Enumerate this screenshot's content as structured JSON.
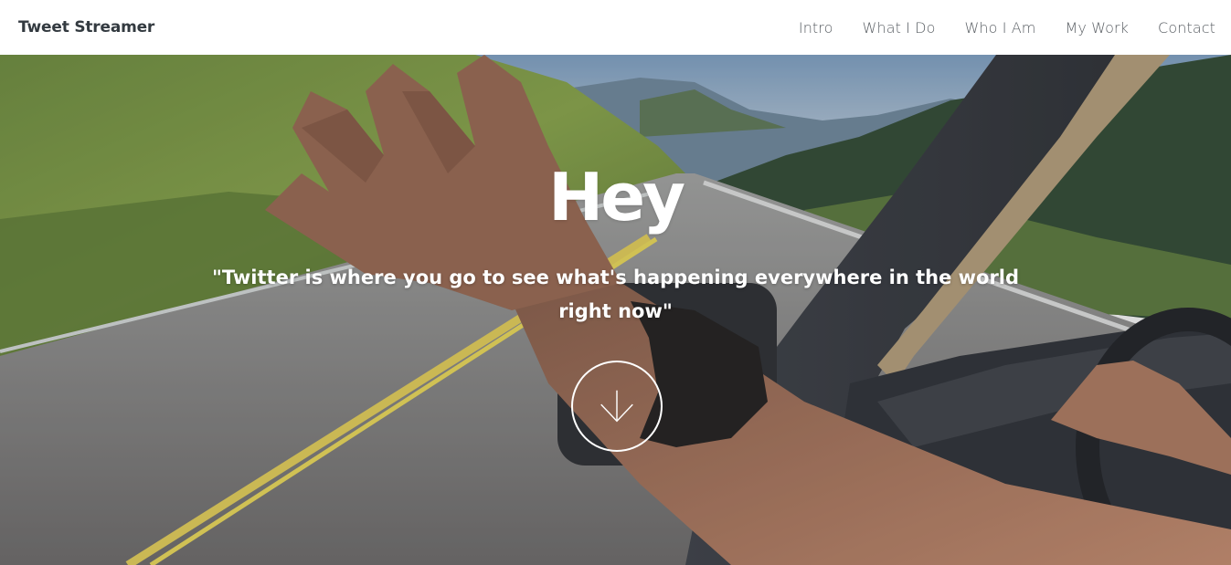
{
  "navbar": {
    "brand": "Tweet Streamer",
    "links": [
      "Intro",
      "What I Do",
      "Who I Am",
      "My Work",
      "Contact"
    ]
  },
  "hero": {
    "title": "Hey",
    "quote": "\"Twitter is where you go to see what's happening everywhere in the world right now\"",
    "scroll_icon": "arrow-down-icon",
    "background": "road-trip-photo"
  },
  "colors": {
    "brand_text": "#333a40",
    "nav_text": "#5a5f64",
    "hero_text": "#ffffff"
  }
}
